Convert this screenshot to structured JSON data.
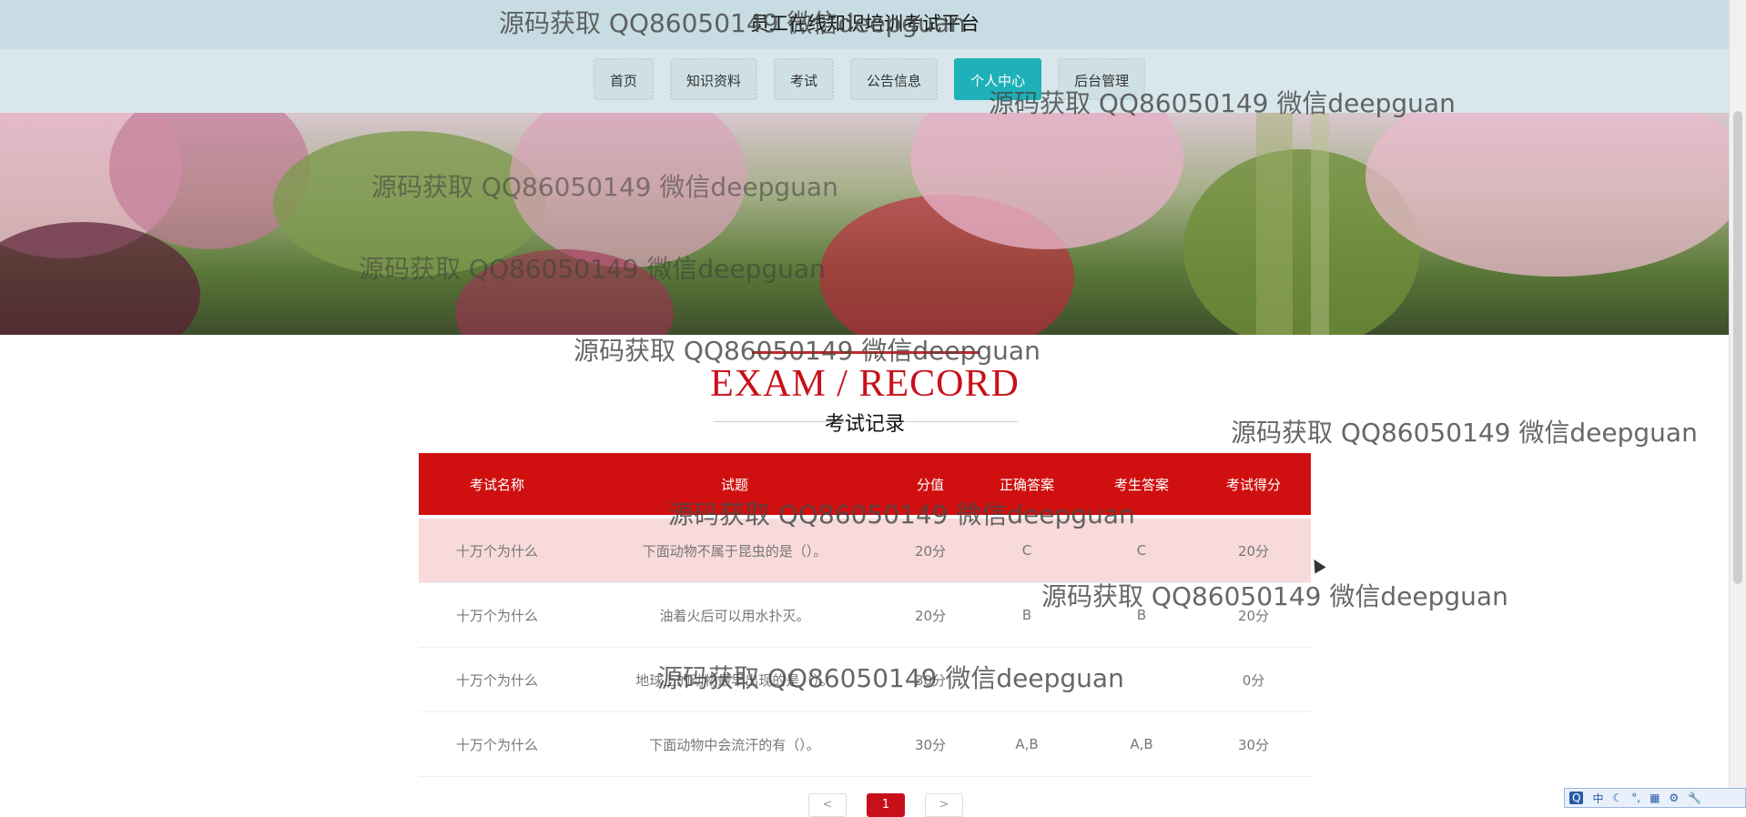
{
  "site_title": "员工在线知识培训考试平台",
  "nav": [
    {
      "label": "首页",
      "active": false
    },
    {
      "label": "知识资料",
      "active": false
    },
    {
      "label": "考试",
      "active": false
    },
    {
      "label": "公告信息",
      "active": false
    },
    {
      "label": "个人中心",
      "active": true
    },
    {
      "label": "后台管理",
      "active": false
    }
  ],
  "section": {
    "title_en": "EXAM / RECORD",
    "title_cn": "考试记录"
  },
  "table": {
    "headers": [
      "考试名称",
      "试题",
      "分值",
      "正确答案",
      "考生答案",
      "考试得分"
    ],
    "rows": [
      [
        "十万个为什么",
        "下面动物不属于昆虫的是（）。",
        "20分",
        "C",
        "C",
        "20分"
      ],
      [
        "十万个为什么",
        "油着火后可以用水扑灭。",
        "20分",
        "B",
        "B",
        "20分"
      ],
      [
        "十万个为什么",
        "地球上的动物最早出现的是（）。",
        "30分",
        "",
        "",
        "0分"
      ],
      [
        "十万个为什么",
        "下面动物中会流汗的有（）。",
        "30分",
        "A,B",
        "A,B",
        "30分"
      ]
    ]
  },
  "pagination": {
    "prev": "<",
    "current": "1",
    "next": ">"
  },
  "watermark": "源码获取 QQ86050149 微信deepguan",
  "ime": [
    "中",
    "☾",
    "°,",
    "▦",
    "⚙",
    "🔧"
  ],
  "colors": {
    "accent": "#c8101a",
    "nav_active": "#1eb1b9",
    "header_bg": "#c7dde3"
  }
}
